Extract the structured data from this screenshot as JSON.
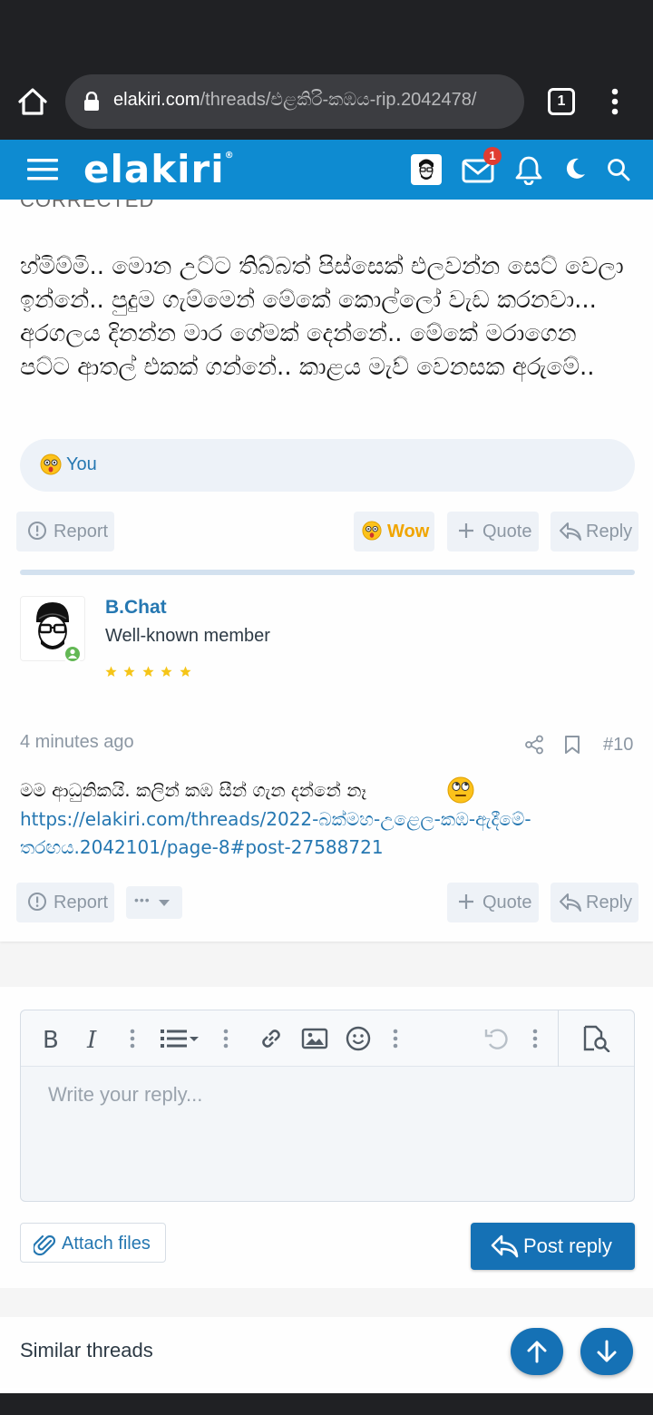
{
  "browser": {
    "url_domain": "elakiri.com",
    "url_path": "/threads/එළකිරි-කඹය-rip.2042478/",
    "tab_count": "1"
  },
  "header": {
    "logo": "elakiri",
    "logo_mark": "®",
    "mail_badge": "1"
  },
  "post1": {
    "cut_heading": "CORRECTED",
    "body": "හ්මිම්මි.. මොන උට්ට තිබ්බත් පිස්සෙක් එලවන්න සෙට් වෙලා ඉන්නේ.. පුදුම ගැම්මෙන් මේකේ කොල්ලෝ වැඩ කරනවා... අරගලය දිනන්න මාර ගේමක් දෙන්නේ.. මේකේ මරාගෙන පට්ට ආතල් එකක් ගන්නේ.. කාළය මැව් වෙනසක අරුමේ..",
    "reaction_user": "You",
    "actions": {
      "report": "Report",
      "wow": "Wow",
      "quote": "Quote",
      "reply": "Reply"
    }
  },
  "post2": {
    "username": "B.Chat",
    "user_title": "Well-known member",
    "date": "4 minutes ago",
    "post_number": "#10",
    "text": "මම ආධුනිකයි. කලින් කඹ සීන් ගැන දන්නේ නෑ",
    "link": "https://elakiri.com/threads/2022-බක්මහ-උළෙල-කඹ-ඇදීමේ-තරඟය.2042101/page-8#post-27588721",
    "actions": {
      "report": "Report",
      "more": "•••",
      "quote": "Quote",
      "reply": "Reply"
    }
  },
  "editor": {
    "placeholder": "Write your reply...",
    "attach_label": "Attach files",
    "post_reply_label": "Post reply"
  },
  "similar": {
    "title": "Similar threads"
  },
  "colors": {
    "brand": "#0e8bd1",
    "link": "#2577b1",
    "primary_button": "#1571b5",
    "wow": "#f0a500"
  }
}
